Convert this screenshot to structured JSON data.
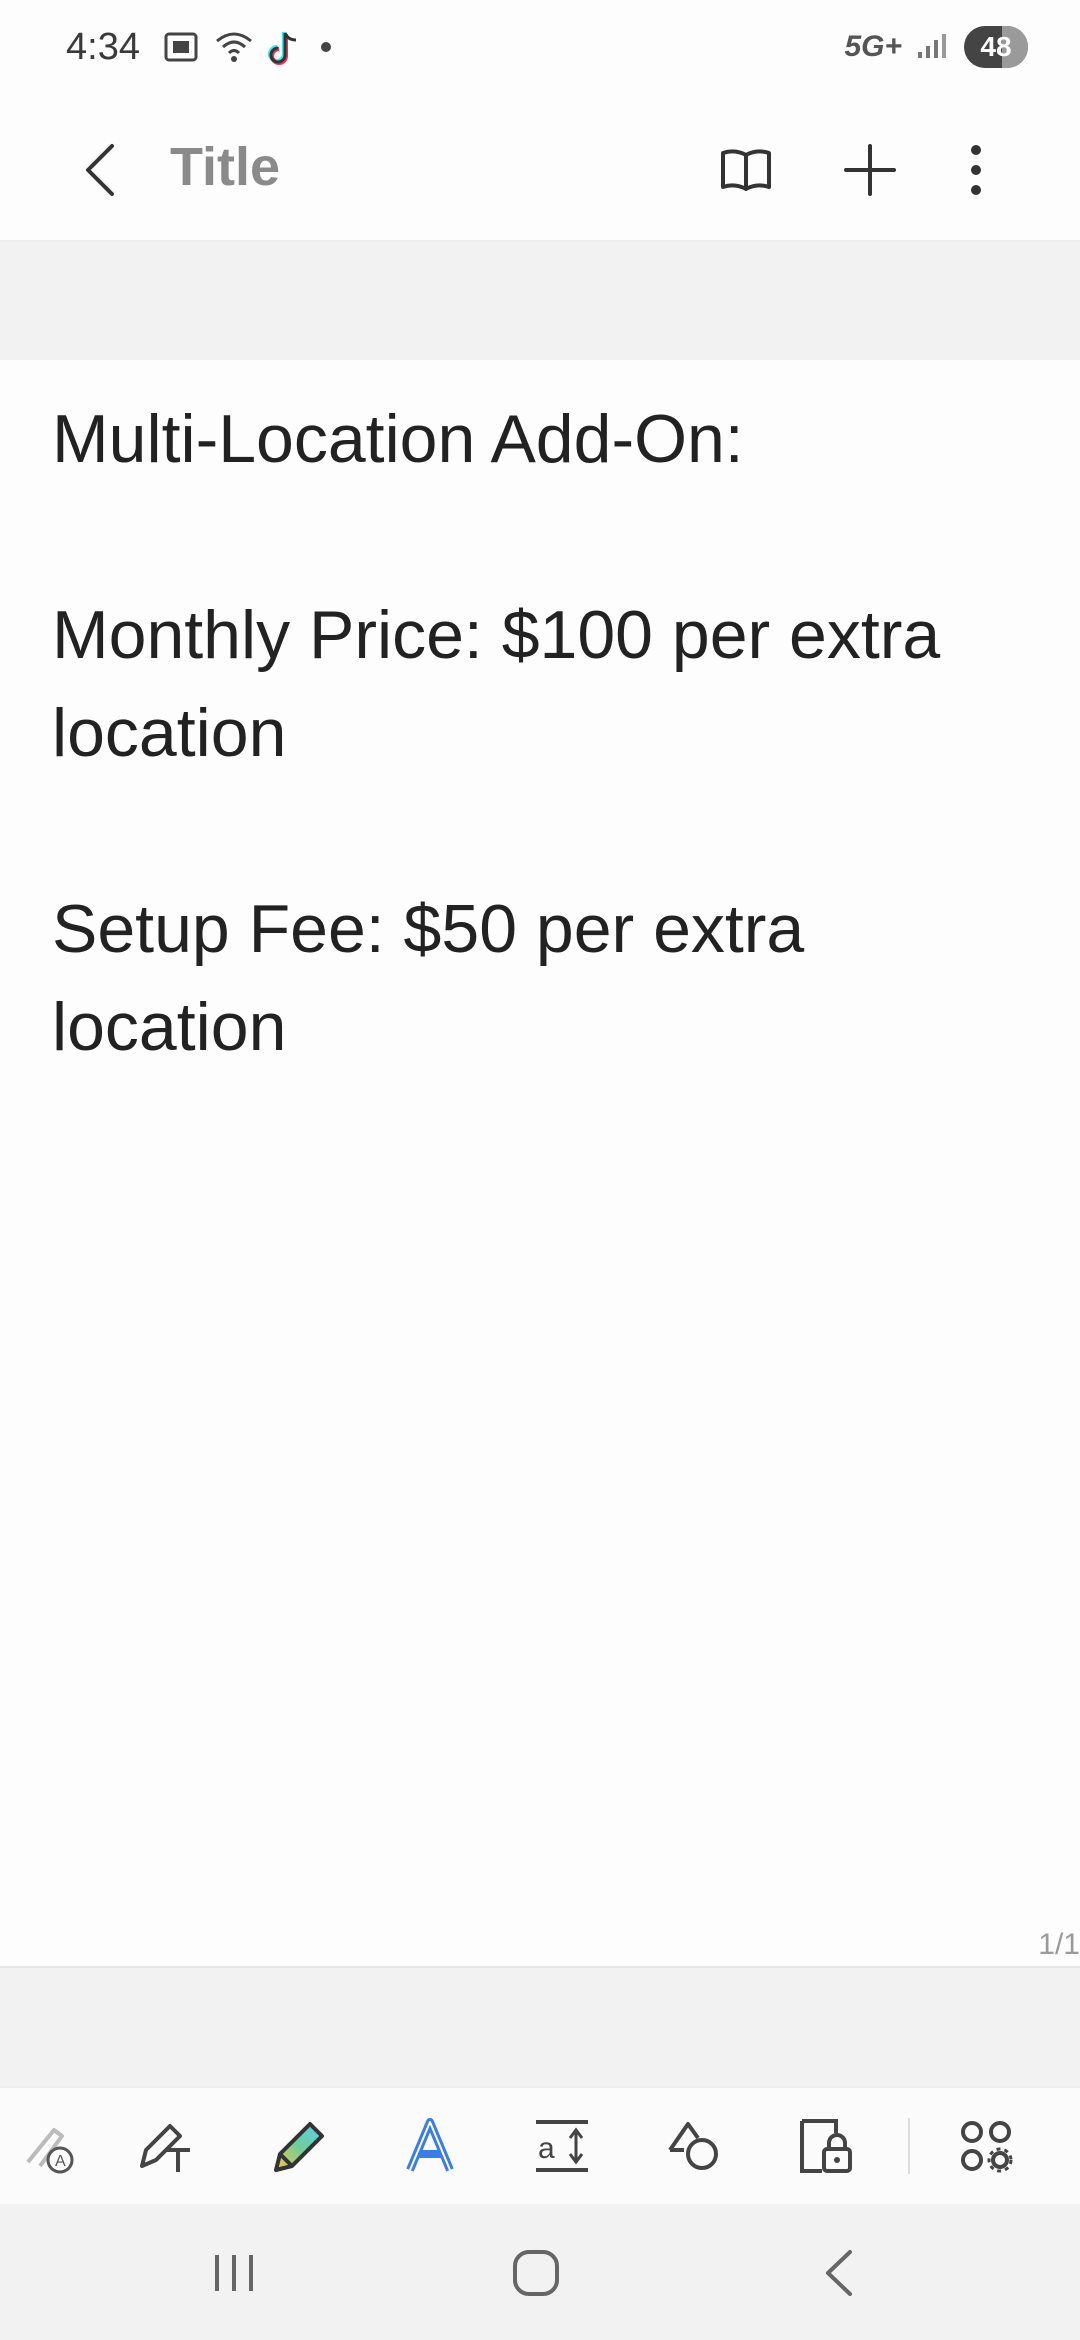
{
  "status_bar": {
    "time": "4:34",
    "network": "5G+",
    "battery": "48",
    "icons": [
      "screenshot-icon",
      "wifi-icon",
      "tiktok-icon",
      "dot-icon",
      "signal-icon"
    ]
  },
  "app_bar": {
    "title": "Title",
    "icons": [
      "back-icon",
      "book-icon",
      "add-icon",
      "more-icon"
    ]
  },
  "note": {
    "lines": [
      "Multi-Location Add-On:",
      "Monthly Price: $100 per extra location",
      "Setup Fee: $50 per extra location"
    ],
    "page_indicator": "1/1"
  },
  "toolbar": {
    "tools": [
      "handwriting-to-text-icon",
      "text-pen-icon",
      "highlighter-pen-icon",
      "text-style-icon",
      "text-size-icon",
      "shapes-icon",
      "lock-icon",
      "more-tools-icon"
    ]
  },
  "nav_bar": {
    "buttons": [
      "recents-icon",
      "home-icon",
      "back-nav-icon"
    ]
  },
  "colors": {
    "background": "#fdfdfd",
    "band": "#f2f2f2",
    "text": "#222222",
    "title": "#8a8a8a",
    "accent_blue": "#3a7de8"
  }
}
